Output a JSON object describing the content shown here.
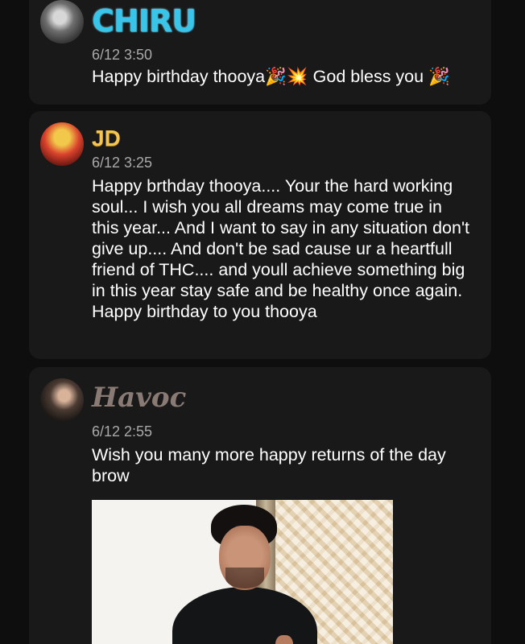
{
  "posts": [
    {
      "author": "CHIRU",
      "time": "6/12 3:50",
      "message": "Happy birthday thooya🎉💥 God bless you 🎉"
    },
    {
      "author": "JD",
      "time": "6/12 3:25",
      "message": "Happy brthday thooya.... Your the hard working soul... I wish you all dreams may come true in this year... And I want to say in any situation don't give up.... And don't be sad cause ur a heartfull friend of THC.... and youll achieve something big in this year stay safe and be healthy once again. Happy birthday to you thooya"
    },
    {
      "author": "Havoc",
      "time": "6/12 2:55",
      "message": "Wish you many more happy returns of the day brow"
    }
  ]
}
